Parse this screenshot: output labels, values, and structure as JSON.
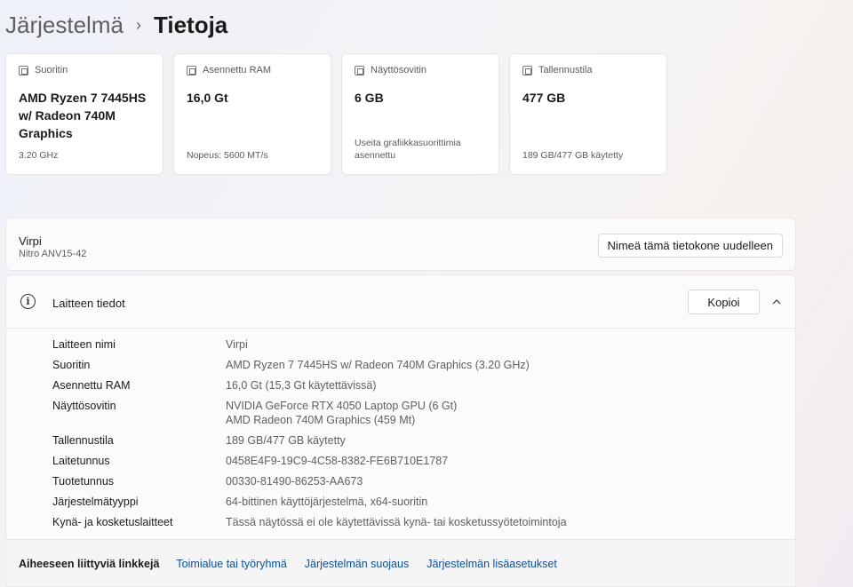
{
  "breadcrumb": {
    "parent": "Järjestelmä",
    "separator": "›",
    "current": "Tietoja"
  },
  "cards": [
    {
      "icon": "processor-icon",
      "label": "Suoritin",
      "value": "AMD Ryzen 7 7445HS w/ Radeon 740M Graphics",
      "footer": "3.20 GHz"
    },
    {
      "icon": "memory-icon",
      "label": "Asennettu RAM",
      "value": "16,0 Gt",
      "footer": "Nopeus: 5600 MT/s"
    },
    {
      "icon": "display-adapter-icon",
      "label": "Näyttösovitin",
      "value": "6 GB",
      "footer": "Useita grafiikkasuorittimia asennettu"
    },
    {
      "icon": "storage-icon",
      "label": "Tallennustila",
      "value": "477 GB",
      "footer": "189 GB/477 GB käytetty"
    }
  ],
  "device": {
    "name": "Virpi",
    "model": "Nitro ANV15-42",
    "rename_label": "Nimeä tämä tietokone uudelleen"
  },
  "specs": {
    "title": "Laitteen tiedot",
    "copy_label": "Kopioi",
    "rows": [
      {
        "label": "Laitteen nimi",
        "value": "Virpi"
      },
      {
        "label": "Suoritin",
        "value": "AMD Ryzen 7 7445HS w/ Radeon 740M Graphics (3.20 GHz)"
      },
      {
        "label": "Asennettu RAM",
        "value": "16,0 Gt (15,3 Gt käytettävissä)"
      },
      {
        "label": "Näyttösovitin",
        "value": "NVIDIA GeForce RTX 4050 Laptop GPU (6 Gt)",
        "value2": "AMD Radeon 740M Graphics (459 Mt)"
      },
      {
        "label": "Tallennustila",
        "value": "189 GB/477 GB käytetty"
      },
      {
        "label": "Laitetunnus",
        "value": "0458E4F9-19C9-4C58-8382-FE6B710E1787"
      },
      {
        "label": "Tuotetunnus",
        "value": "00330-81490-86253-AA673"
      },
      {
        "label": "Järjestelmätyyppi",
        "value": "64-bittinen käyttöjärjestelmä, x64-suoritin"
      },
      {
        "label": "Kynä- ja kosketuslaitteet",
        "value": "Tässä näytössä ei ole käytettävissä kynä- tai kosketussyötetoimintoja"
      }
    ]
  },
  "related": {
    "title": "Aiheeseen liittyviä linkkejä",
    "links": [
      "Toimialue tai työryhmä",
      "Järjestelmän suojaus",
      "Järjestelmän lisäasetukset"
    ]
  }
}
